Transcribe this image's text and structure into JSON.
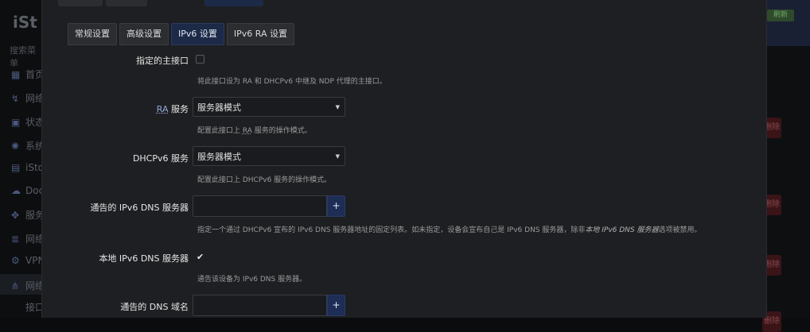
{
  "background": {
    "logo": "iSt",
    "search": "搜索菜单",
    "sidebar": [
      {
        "label": "首页",
        "icon": "dashboard-icon"
      },
      {
        "label": "网络",
        "icon": "network-icon"
      },
      {
        "label": "状态",
        "icon": "status-icon"
      },
      {
        "label": "系统",
        "icon": "system-icon"
      },
      {
        "label": "iSto",
        "icon": "store-icon"
      },
      {
        "label": "Doc",
        "icon": "docker-icon"
      },
      {
        "label": "服务",
        "icon": "services-icon"
      },
      {
        "label": "网络",
        "icon": "nas-icon"
      },
      {
        "label": "VPN",
        "icon": "vpn-icon"
      },
      {
        "label": "网络",
        "icon": "network-active-icon"
      },
      {
        "label": "接口",
        "icon": ""
      }
    ],
    "green_badge": "刷新",
    "delete_label": "删除"
  },
  "tabs": [
    {
      "label": "常规设置",
      "active": false
    },
    {
      "label": "高级设置",
      "active": false
    },
    {
      "label": "IPv6 设置",
      "active": true
    },
    {
      "label": "IPv6 RA 设置",
      "active": false
    }
  ],
  "form": {
    "master": {
      "label": "指定的主接口",
      "checked": false,
      "desc": "将此接口设为 RA 和 DHCPv6 中继及 NDP 代理的主接口。"
    },
    "ra": {
      "label_abbr": "RA",
      "label_rest": " 服务",
      "value": "服务器模式",
      "desc_pre": "配置此接口上 ",
      "desc_abbr": "RA",
      "desc_post": " 服务的操作模式。"
    },
    "dhcpv6": {
      "label": "DHCPv6 服务",
      "value": "服务器模式",
      "desc": "配置此接口上 DHCPv6 服务的操作模式。"
    },
    "dns_servers": {
      "label": "通告的 IPv6 DNS 服务器",
      "value": "",
      "add": "+",
      "desc_pre": "指定一个通过 DHCPv6 宣布的 IPv6 DNS 服务器地址的固定列表。如未指定，设备会宣布自己是 IPv6 DNS 服务器，除非",
      "desc_em": "本地 IPv6 DNS 服务器",
      "desc_post": "选项被禁用。"
    },
    "local_dns": {
      "label": "本地 IPv6 DNS 服务器",
      "checked": true,
      "check": "✔",
      "desc": "通告该设备为 IPv6 DNS 服务器。"
    },
    "dns_domains": {
      "label": "通告的 DNS 域名",
      "value": "",
      "add": "+"
    }
  }
}
